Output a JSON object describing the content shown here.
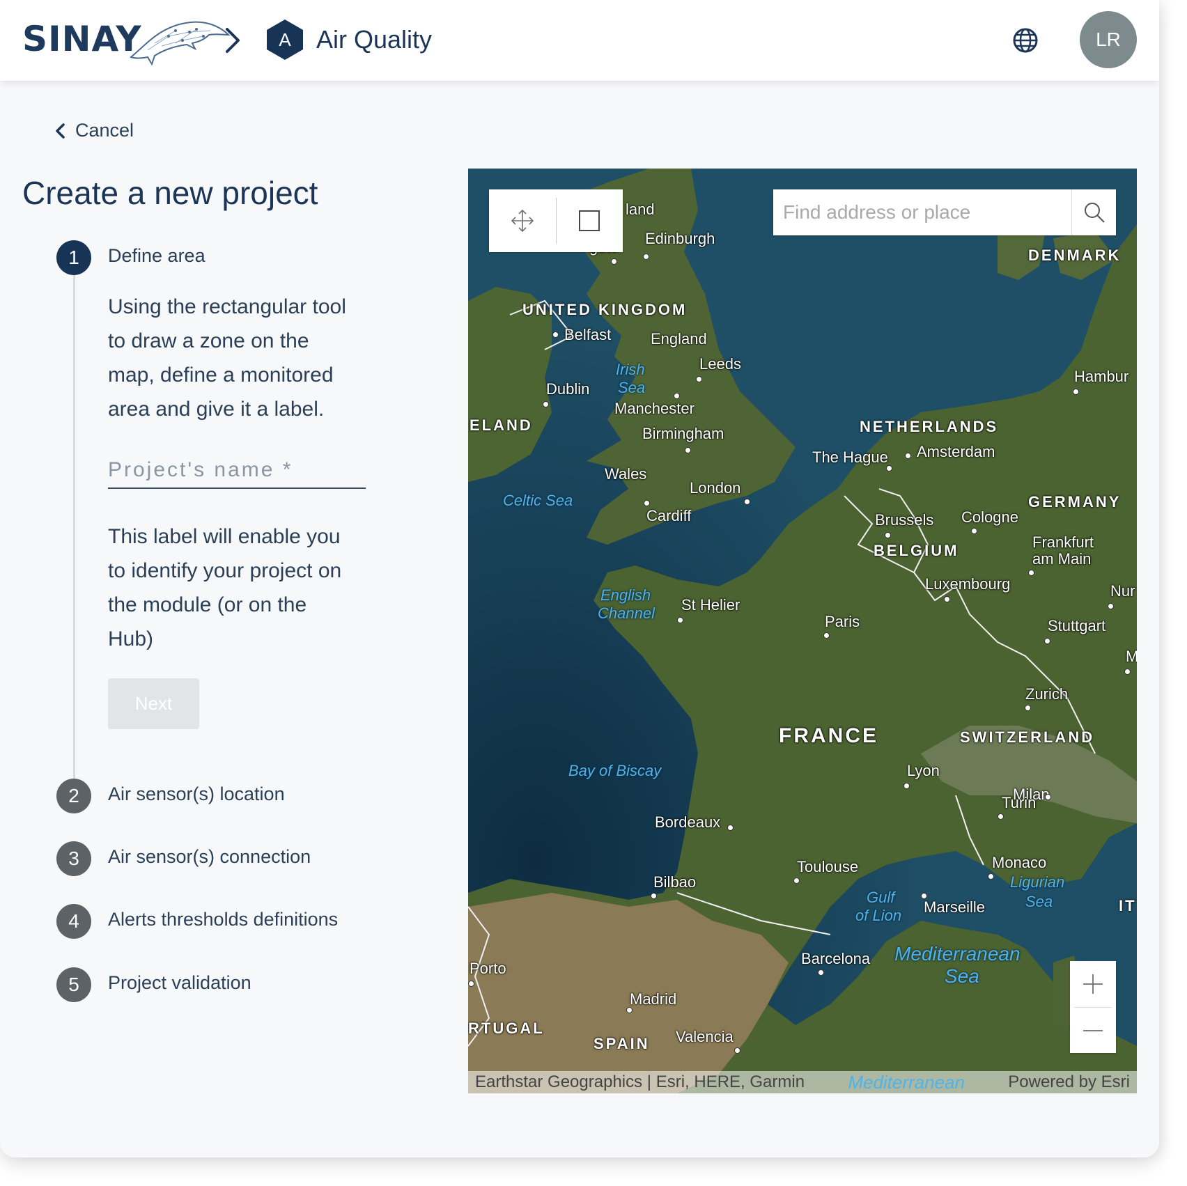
{
  "header": {
    "logo_text": "SINAY",
    "module_badge": "A",
    "module_title": "Air Quality",
    "user_initials": "LR"
  },
  "nav": {
    "cancel_label": "Cancel"
  },
  "page": {
    "title": "Create a new project",
    "description_line1": "Using the rectangular tool",
    "description_line2": "to draw a zone on the",
    "description_line3": "map, define a monitored",
    "description_line4": "area and give it a label.",
    "name_placeholder": "Project's name *",
    "help_line1": "This label will enable you",
    "help_line2": "to identify your project on",
    "help_line3": "the module (or on the",
    "help_line4": "Hub)",
    "next_label": "Next"
  },
  "steps": [
    {
      "number": "1",
      "label": "Define area",
      "active": true
    },
    {
      "number": "2",
      "label": "Air sensor(s) location",
      "active": false
    },
    {
      "number": "3",
      "label": "Air sensor(s) connection",
      "active": false
    },
    {
      "number": "4",
      "label": "Alerts thresholds definitions",
      "active": false
    },
    {
      "number": "5",
      "label": "Project validation",
      "active": false
    }
  ],
  "map": {
    "search_placeholder": "Find address or place",
    "attribution": "Earthstar Geographics | Esri, HERE, Garmin",
    "attribution_sea": "Mediterranean",
    "powered_by": "Powered by Esri",
    "tools": [
      "pan-icon",
      "rectangle-icon"
    ],
    "labels": {
      "scotland_partial": "land",
      "glasgow_partial": "gow",
      "edinburgh": "Edinburgh",
      "denmark": "DENMARK",
      "united_kingdom": "UNITED KINGDOM",
      "belfast": "Belfast",
      "england": "England",
      "irish_sea_1": "Irish",
      "irish_sea_2": "Sea",
      "leeds": "Leeds",
      "hamburg": "Hambur",
      "dublin": "Dublin",
      "manchester": "Manchester",
      "ireland_partial": "ELAND",
      "netherlands": "NETHERLANDS",
      "birmingham": "Birmingham",
      "the_hague": "The Hague",
      "amsterdam": "Amsterdam",
      "wales": "Wales",
      "london": "London",
      "celtic_sea": "Celtic Sea",
      "germany": "GERMANY",
      "cardiff": "Cardiff",
      "brussels": "Brussels",
      "cologne": "Cologne",
      "belgium": "BELGIUM",
      "frankfurt_1": "Frankfurt",
      "frankfurt_2": "am Main",
      "luxembourg": "Luxembourg",
      "nurnberg_partial": "Nur",
      "english_channel_1": "English",
      "english_channel_2": "Channel",
      "st_helier": "St Helier",
      "paris": "Paris",
      "stuttgart": "Stuttgart",
      "munich_partial": "M",
      "zurich": "Zurich",
      "france": "FRANCE",
      "switzerland": "SWITZERLAND",
      "bay_of_biscay": "Bay of Biscay",
      "lyon": "Lyon",
      "milan": "Milan",
      "turin": "Turin",
      "bordeaux": "Bordeaux",
      "toulouse": "Toulouse",
      "monaco": "Monaco",
      "bilbao": "Bilbao",
      "ligurian_sea_1": "Ligurian",
      "ligurian_sea_2": "Sea",
      "gulf_of_lion_1": "Gulf",
      "gulf_of_lion_2": "of Lion",
      "marseille": "Marseille",
      "italy_partial": "IT",
      "mediterranean_1": "Mediterranean",
      "mediterranean_2": "Sea",
      "porto": "Porto",
      "barcelona": "Barcelona",
      "madrid": "Madrid",
      "portugal_partial": "RTUGAL",
      "spain": "SPAIN",
      "valencia": "Valencia"
    }
  },
  "colors": {
    "brand_navy": "#173457",
    "step_inactive": "#5d6266",
    "avatar_bg": "#7d8a8e",
    "sea": "#1f4f66",
    "land": "#4b6231"
  }
}
